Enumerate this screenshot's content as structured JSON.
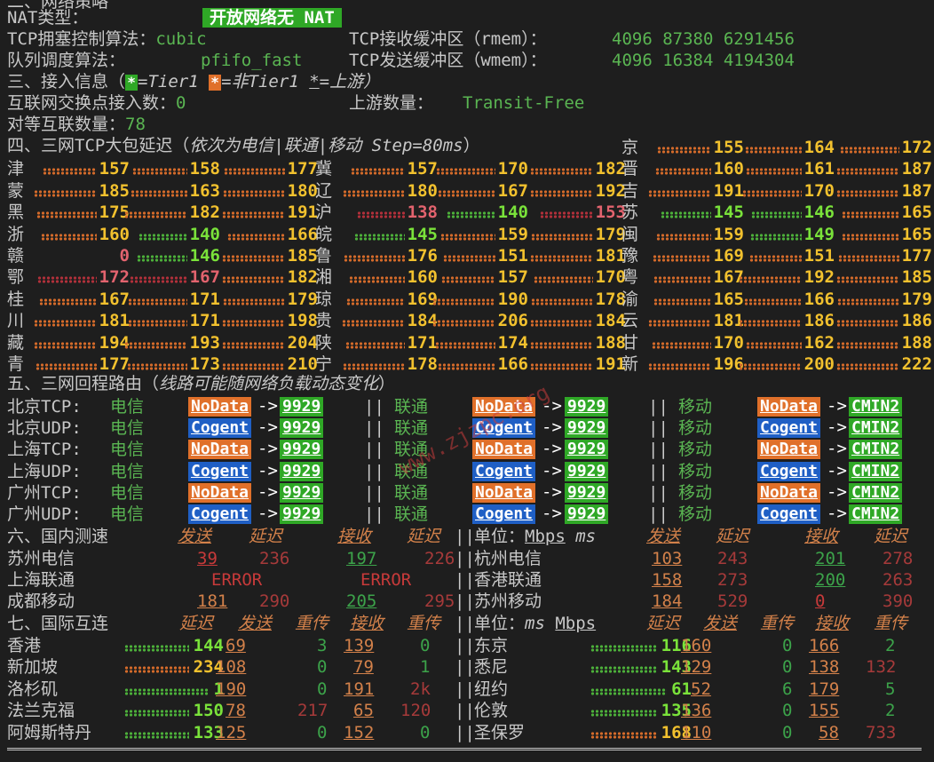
{
  "section2": {
    "partial_header": "二、网络策略",
    "nat_label": "NAT类型：",
    "nat_value": "开放网络无 NAT",
    "tcp_algo_label": "TCP拥塞控制算法：",
    "tcp_algo_value": "cubic",
    "rmem_label": "TCP接收缓冲区（rmem）：",
    "rmem_value": "4096 87380 6291456",
    "qdisc_label": "队列调度算法：",
    "qdisc_value": "pfifo_fast",
    "wmem_label": "TCP发送缓冲区（wmem）：",
    "wmem_value": "4096 16384 4194304"
  },
  "section3": {
    "title": "三、接入信息（",
    "legend_tier1": "=Tier1",
    "legend_nontier1": "=非Tier1",
    "legend_upstream": "=上游）",
    "ix_label": "互联网交换点接入数：",
    "ix_value": "0",
    "upstream_label": "上游数量：",
    "upstream_value": "Transit-Free",
    "peers_label": "对等互联数量：",
    "peers_value": "78",
    "star": "*"
  },
  "section4": {
    "title": "四、三网TCP大包延迟（",
    "subtitle": "依次为电信|联通|移动 Step=80ms",
    "close": "）",
    "provinces": [
      {
        "name": "京",
        "col": 2,
        "row": 0,
        "v": [
          "155",
          "164",
          "172"
        ],
        "c": [
          "y",
          "y",
          "y"
        ]
      },
      {
        "name": "津",
        "col": 0,
        "row": 1,
        "v": [
          "157",
          "158",
          "177"
        ],
        "c": [
          "y",
          "y",
          "y"
        ]
      },
      {
        "name": "冀",
        "col": 1,
        "row": 1,
        "v": [
          "157",
          "170",
          "182"
        ],
        "c": [
          "y",
          "y",
          "y"
        ]
      },
      {
        "name": "晋",
        "col": 2,
        "row": 1,
        "v": [
          "160",
          "161",
          "187"
        ],
        "c": [
          "y",
          "y",
          "y"
        ]
      },
      {
        "name": "蒙",
        "col": 0,
        "row": 2,
        "v": [
          "185",
          "163",
          "180"
        ],
        "c": [
          "y",
          "y",
          "y"
        ]
      },
      {
        "name": "辽",
        "col": 1,
        "row": 2,
        "v": [
          "180",
          "167",
          "192"
        ],
        "c": [
          "y",
          "y",
          "y"
        ]
      },
      {
        "name": "吉",
        "col": 2,
        "row": 2,
        "v": [
          "191",
          "170",
          "187"
        ],
        "c": [
          "y",
          "y",
          "y"
        ]
      },
      {
        "name": "黑",
        "col": 0,
        "row": 3,
        "v": [
          "175",
          "182",
          "191"
        ],
        "c": [
          "y",
          "y",
          "y"
        ]
      },
      {
        "name": "沪",
        "col": 1,
        "row": 3,
        "v": [
          "138",
          "140",
          "153"
        ],
        "c": [
          "r",
          "gr",
          "r"
        ]
      },
      {
        "name": "苏",
        "col": 2,
        "row": 3,
        "v": [
          "145",
          "146",
          "165"
        ],
        "c": [
          "gr",
          "gr",
          "y"
        ]
      },
      {
        "name": "浙",
        "col": 0,
        "row": 4,
        "v": [
          "160",
          "140",
          "166"
        ],
        "c": [
          "y",
          "gr",
          "y"
        ]
      },
      {
        "name": "皖",
        "col": 1,
        "row": 4,
        "v": [
          "145",
          "159",
          "179"
        ],
        "c": [
          "gr",
          "y",
          "y"
        ]
      },
      {
        "name": "闽",
        "col": 2,
        "row": 4,
        "v": [
          "159",
          "149",
          "165"
        ],
        "c": [
          "y",
          "gr",
          "y"
        ]
      },
      {
        "name": "赣",
        "col": 0,
        "row": 5,
        "v": [
          "0",
          "146",
          "185"
        ],
        "c": [
          "r",
          "gr",
          "y"
        ]
      },
      {
        "name": "鲁",
        "col": 1,
        "row": 5,
        "v": [
          "176",
          "151",
          "181"
        ],
        "c": [
          "y",
          "y",
          "y"
        ]
      },
      {
        "name": "豫",
        "col": 2,
        "row": 5,
        "v": [
          "169",
          "151",
          "177"
        ],
        "c": [
          "y",
          "y",
          "y"
        ]
      },
      {
        "name": "鄂",
        "col": 0,
        "row": 6,
        "v": [
          "172",
          "167",
          "182"
        ],
        "c": [
          "r",
          "r",
          "y"
        ]
      },
      {
        "name": "湘",
        "col": 1,
        "row": 6,
        "v": [
          "160",
          "157",
          "170"
        ],
        "c": [
          "y",
          "y",
          "y"
        ]
      },
      {
        "name": "粤",
        "col": 2,
        "row": 6,
        "v": [
          "167",
          "192",
          "185"
        ],
        "c": [
          "y",
          "y",
          "y"
        ]
      },
      {
        "name": "桂",
        "col": 0,
        "row": 7,
        "v": [
          "167",
          "171",
          "179"
        ],
        "c": [
          "y",
          "y",
          "y"
        ]
      },
      {
        "name": "琼",
        "col": 1,
        "row": 7,
        "v": [
          "169",
          "190",
          "178"
        ],
        "c": [
          "y",
          "y",
          "y"
        ]
      },
      {
        "name": "渝",
        "col": 2,
        "row": 7,
        "v": [
          "165",
          "166",
          "179"
        ],
        "c": [
          "y",
          "y",
          "y"
        ]
      },
      {
        "name": "川",
        "col": 0,
        "row": 8,
        "v": [
          "181",
          "171",
          "198"
        ],
        "c": [
          "y",
          "y",
          "y"
        ]
      },
      {
        "name": "贵",
        "col": 1,
        "row": 8,
        "v": [
          "184",
          "206",
          "184"
        ],
        "c": [
          "y",
          "y",
          "y"
        ]
      },
      {
        "name": "云",
        "col": 2,
        "row": 8,
        "v": [
          "181",
          "186",
          "186"
        ],
        "c": [
          "y",
          "y",
          "y"
        ]
      },
      {
        "name": "藏",
        "col": 0,
        "row": 9,
        "v": [
          "194",
          "193",
          "204"
        ],
        "c": [
          "y",
          "y",
          "y"
        ]
      },
      {
        "name": "陕",
        "col": 1,
        "row": 9,
        "v": [
          "171",
          "174",
          "188"
        ],
        "c": [
          "y",
          "y",
          "y"
        ]
      },
      {
        "name": "甘",
        "col": 2,
        "row": 9,
        "v": [
          "170",
          "162",
          "188"
        ],
        "c": [
          "y",
          "y",
          "y"
        ]
      },
      {
        "name": "青",
        "col": 0,
        "row": 10,
        "v": [
          "177",
          "173",
          "210"
        ],
        "c": [
          "y",
          "y",
          "y"
        ]
      },
      {
        "name": "宁",
        "col": 1,
        "row": 10,
        "v": [
          "178",
          "166",
          "191"
        ],
        "c": [
          "y",
          "y",
          "y"
        ]
      },
      {
        "name": "新",
        "col": 2,
        "row": 10,
        "v": [
          "196",
          "200",
          "222"
        ],
        "c": [
          "y",
          "y",
          "y"
        ]
      }
    ]
  },
  "section5": {
    "title": "五、三网回程路由（",
    "subtitle": "线路可能随网络负载动态变化",
    "close": "）",
    "sep": "||",
    "arrow": "->",
    "isp_ct": "电信",
    "isp_cu": "联通",
    "isp_cm": "移动",
    "rows": [
      {
        "city": "北京",
        "proto": "TCP:",
        "ct": [
          "NoData",
          "9929"
        ],
        "cu": [
          "NoData",
          "9929"
        ],
        "cm": [
          "NoData",
          "CMIN2"
        ],
        "t": "o"
      },
      {
        "city": "北京",
        "proto": "UDP:",
        "ct": [
          "Cogent",
          "9929"
        ],
        "cu": [
          "Cogent",
          "9929"
        ],
        "cm": [
          "Cogent",
          "CMIN2"
        ],
        "t": "b"
      },
      {
        "city": "上海",
        "proto": "TCP:",
        "ct": [
          "NoData",
          "9929"
        ],
        "cu": [
          "NoData",
          "9929"
        ],
        "cm": [
          "NoData",
          "CMIN2"
        ],
        "t": "o"
      },
      {
        "city": "上海",
        "proto": "UDP:",
        "ct": [
          "Cogent",
          "9929"
        ],
        "cu": [
          "Cogent",
          "9929"
        ],
        "cm": [
          "Cogent",
          "CMIN2"
        ],
        "t": "b"
      },
      {
        "city": "广州",
        "proto": "TCP:",
        "ct": [
          "NoData",
          "9929"
        ],
        "cu": [
          "NoData",
          "9929"
        ],
        "cm": [
          "NoData",
          "CMIN2"
        ],
        "t": "o"
      },
      {
        "city": "广州",
        "proto": "UDP:",
        "ct": [
          "Cogent",
          "9929"
        ],
        "cu": [
          "Cogent",
          "9929"
        ],
        "cm": [
          "Cogent",
          "CMIN2"
        ],
        "t": "b"
      }
    ]
  },
  "section6": {
    "title": "六、国内测速",
    "h_send": "发送",
    "h_lat": "延迟",
    "h_recv": "接收",
    "h_lat2": "延迟",
    "unit": "单位：",
    "unit_mbps": "Mbps",
    "unit_ms": "ms",
    "sep": "||",
    "left": [
      {
        "name": "苏州电信",
        "send": "39",
        "lat": "236",
        "recv": "197",
        "lat2": "226"
      },
      {
        "name": "上海联通",
        "send": "ERROR",
        "lat": "",
        "recv": "ERROR",
        "lat2": ""
      },
      {
        "name": "成都移动",
        "send": "181",
        "lat": "290",
        "recv": "205",
        "lat2": "295"
      }
    ],
    "right": [
      {
        "name": "杭州电信",
        "send": "103",
        "lat": "243",
        "recv": "201",
        "lat2": "278"
      },
      {
        "name": "香港联通",
        "send": "158",
        "lat": "273",
        "recv": "200",
        "lat2": "263"
      },
      {
        "name": "苏州移动",
        "send": "184",
        "lat": "529",
        "recv": "0",
        "lat2": "390"
      }
    ]
  },
  "section7": {
    "title": "七、国际互连",
    "h_lat": "延迟",
    "h_send": "发送",
    "h_retx": "重传",
    "h_recv": "接收",
    "h_retx2": "重传",
    "unit": "单位：",
    "unit_ms": "ms",
    "unit_mbps": "Mbps",
    "sep": "||",
    "left": [
      {
        "name": "香港",
        "lat": "144",
        "send": "69",
        "r1": "3",
        "recv": "139",
        "r2": "0",
        "c": "gr"
      },
      {
        "name": "新加坡",
        "lat": "234",
        "send": "108",
        "r1": "0",
        "recv": "79",
        "r2": "1",
        "c": "y"
      },
      {
        "name": "洛杉矶",
        "lat": "1",
        "send": "190",
        "r1": "0",
        "recv": "191",
        "r2": "2k",
        "c": "gr"
      },
      {
        "name": "法兰克福",
        "lat": "150",
        "send": "78",
        "r1": "217",
        "recv": "65",
        "r2": "120",
        "c": "gr"
      },
      {
        "name": "阿姆斯特丹",
        "lat": "133",
        "send": "125",
        "r1": "0",
        "recv": "152",
        "r2": "0",
        "c": "gr"
      }
    ],
    "right": [
      {
        "name": "东京",
        "lat": "116",
        "send": "160",
        "r1": "0",
        "recv": "166",
        "r2": "2",
        "c": "gr"
      },
      {
        "name": "悉尼",
        "lat": "143",
        "send": "129",
        "r1": "0",
        "recv": "138",
        "r2": "132",
        "c": "gr"
      },
      {
        "name": "纽约",
        "lat": "61",
        "send": "52",
        "r1": "6",
        "recv": "179",
        "r2": "5",
        "c": "gr"
      },
      {
        "name": "伦敦",
        "lat": "135",
        "send": "136",
        "r1": "0",
        "recv": "155",
        "r2": "2",
        "c": "gr"
      },
      {
        "name": "圣保罗",
        "lat": "168",
        "send": "110",
        "r1": "0",
        "recv": "58",
        "r2": "733",
        "c": "y"
      }
    ]
  },
  "watermark": "www.zjzpc.org",
  "colors": {
    "bg": "#1e1e1e",
    "text": "#c8c8c8",
    "green": "#5ab552",
    "yellow": "#f2c12e",
    "bright_green": "#7ae23a",
    "red": "#e2636e",
    "orange": "#e0702a",
    "blue": "#1f5fc5"
  }
}
